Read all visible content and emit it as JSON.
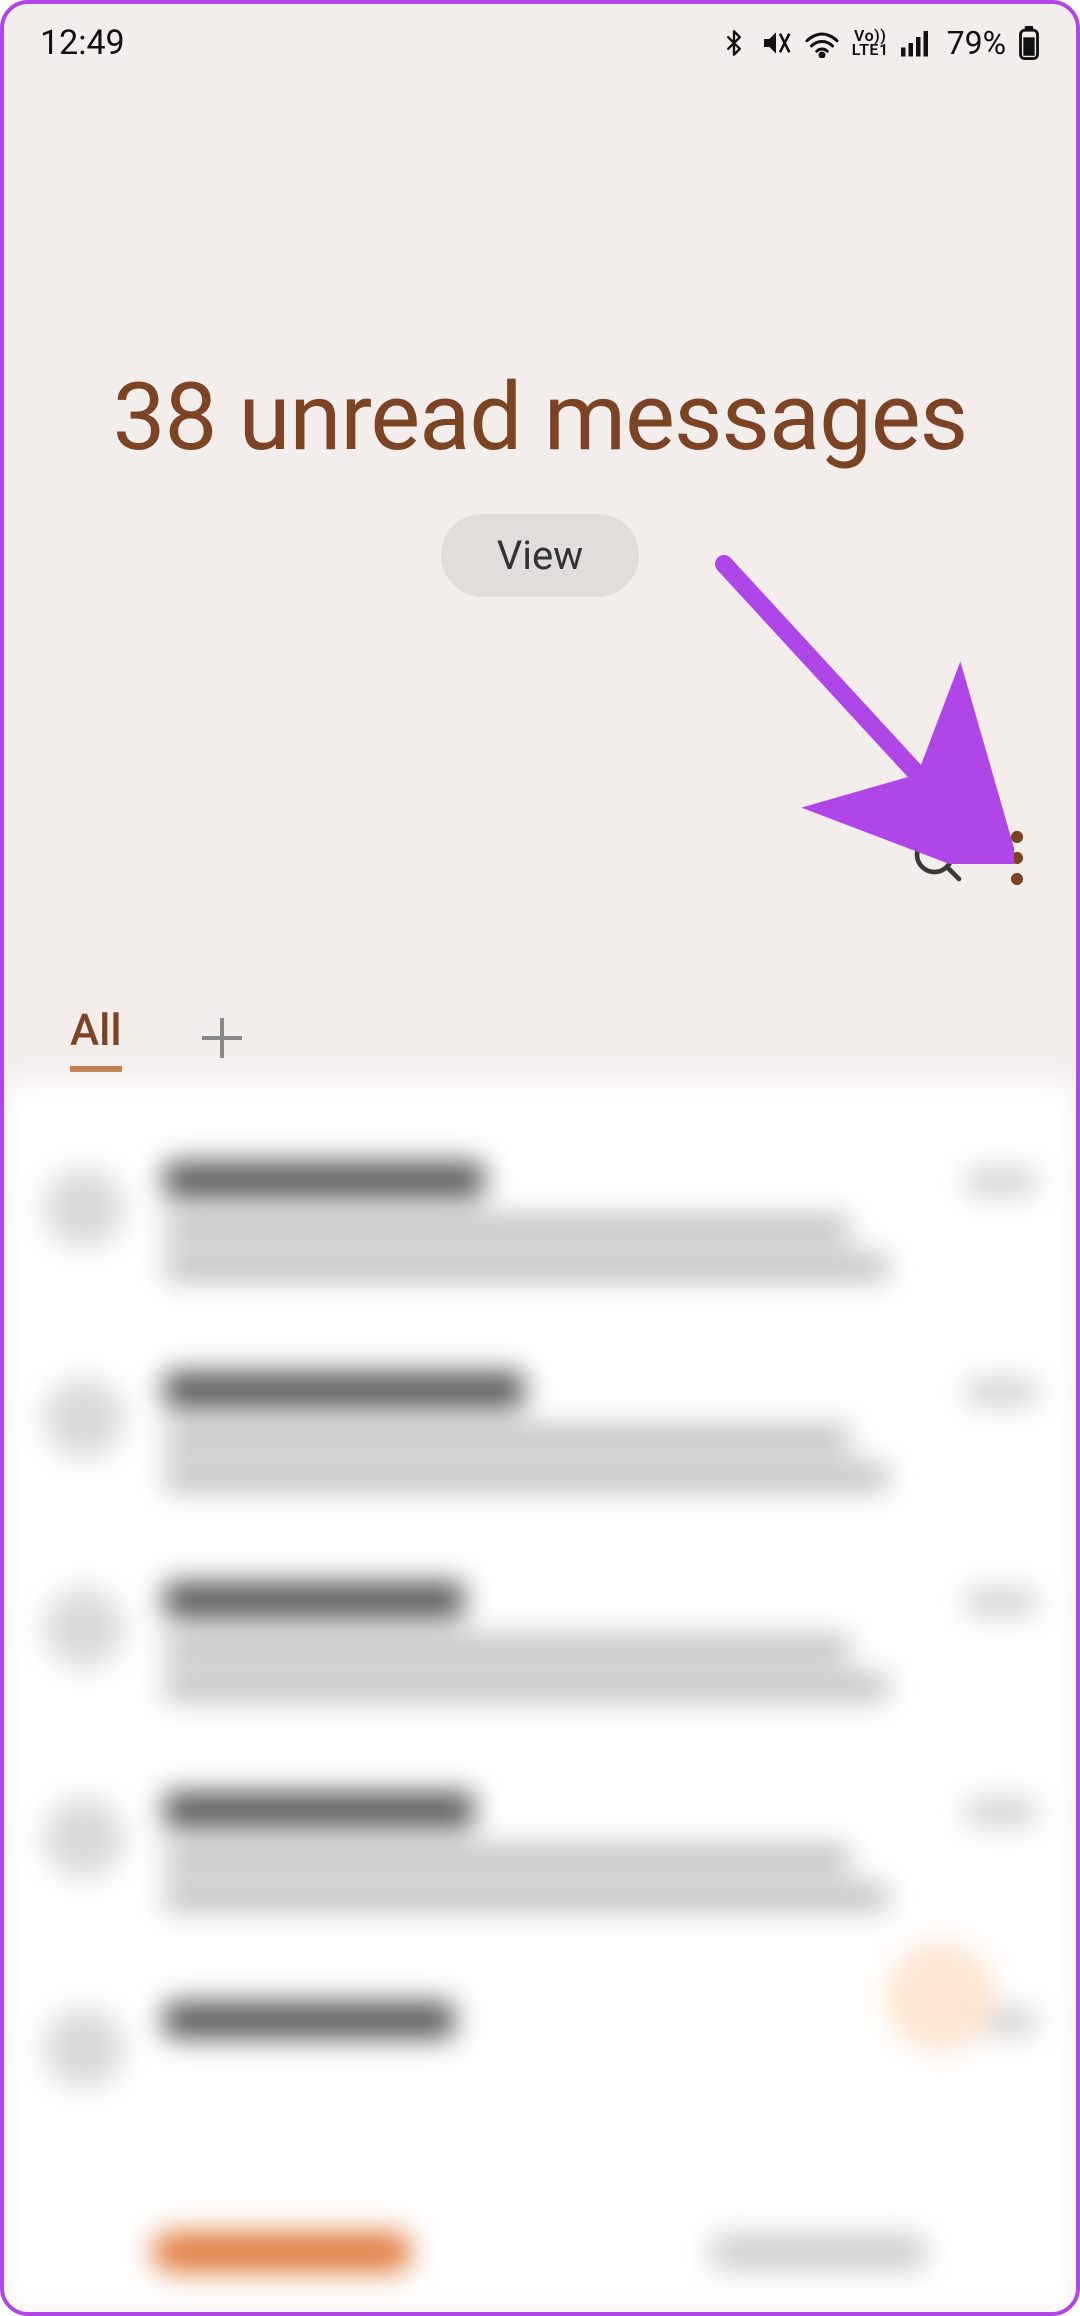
{
  "statusbar": {
    "time": "12:49",
    "battery_pct": "79%",
    "network_label": "Vo))\nLTE1"
  },
  "header": {
    "title": "38 unread messages",
    "view_button": "View"
  },
  "tabs": {
    "all": "All"
  },
  "icons": {
    "bluetooth": "bluetooth",
    "mute": "mute-vibrate",
    "wifi": "wifi",
    "signal": "signal-full",
    "battery": "battery-79",
    "search": "search",
    "more": "more-vertical",
    "add_tab": "plus"
  },
  "annotation": {
    "arrow_target": "more-options-button"
  }
}
